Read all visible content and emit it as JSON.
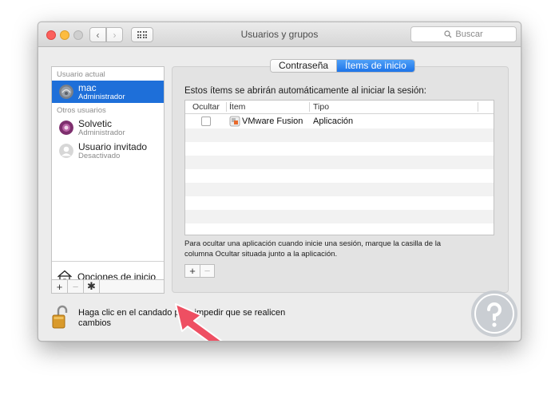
{
  "window": {
    "title": "Usuarios y grupos"
  },
  "search": {
    "placeholder": "Buscar"
  },
  "sidebar": {
    "current_user_label": "Usuario actual",
    "other_users_label": "Otros usuarios",
    "users": [
      {
        "name": "mac",
        "role": "Administrador",
        "selected": true
      },
      {
        "name": "Solvetic",
        "role": "Administrador",
        "selected": false
      },
      {
        "name": "Usuario invitado",
        "role": "Desactivado",
        "selected": false
      }
    ],
    "login_options_label": "Opciones de inicio"
  },
  "tabs": [
    {
      "label": "Contraseña",
      "active": false
    },
    {
      "label": "Ítems de inicio",
      "active": true
    }
  ],
  "login_items": {
    "description": "Estos ítems se abrirán automáticamente al iniciar la sesión:",
    "columns": [
      "Ocultar",
      "Ítem",
      "Tipo"
    ],
    "rows": [
      {
        "hide": false,
        "item": "VMware Fusion",
        "type": "Aplicación"
      }
    ],
    "help_text": "Para ocultar una aplicación cuando inicie una sesión, marque la casilla de la columna Ocultar situada junto a la aplicación."
  },
  "lock": {
    "text": "Haga clic en el candado para impedir que se realicen cambios"
  },
  "colors": {
    "accent": "#1e6fd9",
    "arrow": "#ee4f62",
    "logo": "#c4c9cf"
  }
}
